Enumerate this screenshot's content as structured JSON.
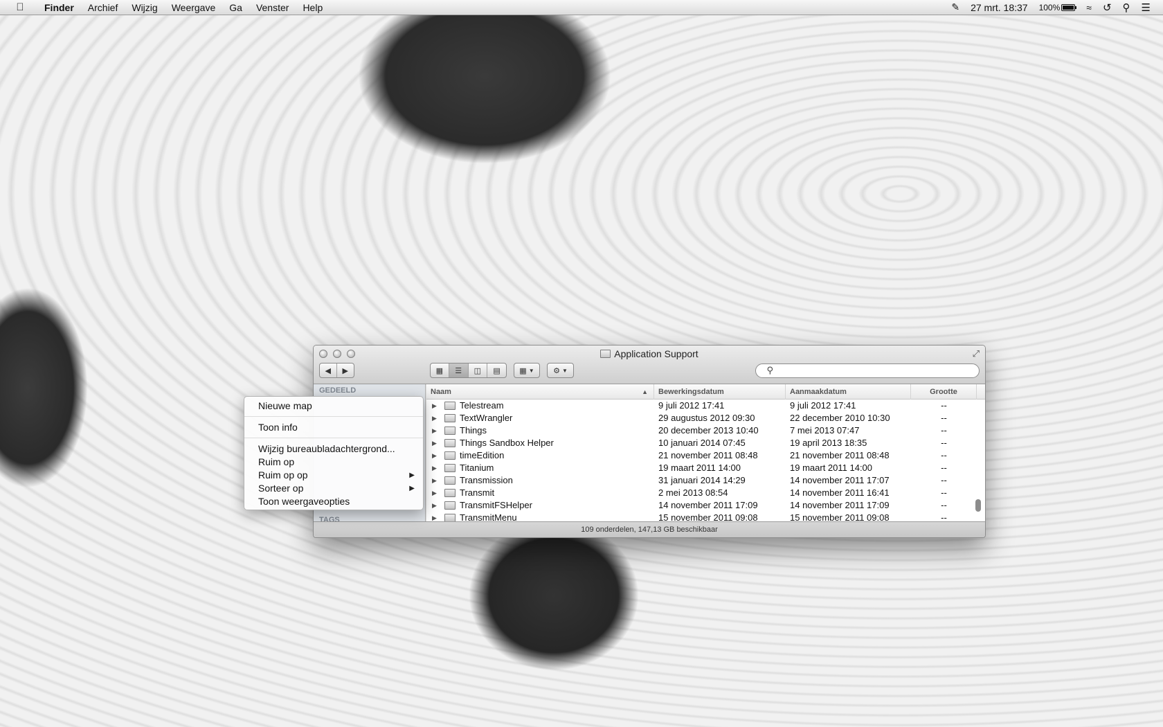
{
  "menubar": {
    "app_name": "Finder",
    "items": [
      "Archief",
      "Wijzig",
      "Weergave",
      "Ga",
      "Venster",
      "Help"
    ],
    "datetime": "27 mrt. 18:37",
    "battery_text": "100%",
    "battery_level": 1.0
  },
  "window": {
    "title": "Application Support",
    "search": {
      "value": "",
      "placeholder": ""
    },
    "status": "109 onderdelen, 147,13 GB beschikbaar"
  },
  "sidebar": {
    "shared_header": "GEDEELD",
    "tags_header": "TAGS"
  },
  "table": {
    "columns": {
      "name": "Naam",
      "modified": "Bewerkingsdatum",
      "created": "Aanmaakdatum",
      "size": "Grootte"
    },
    "rows": [
      {
        "name": "Telestream",
        "modified": "9 juli 2012 17:41",
        "created": "9 juli 2012 17:41",
        "size": "--"
      },
      {
        "name": "TextWrangler",
        "modified": "29 augustus 2012 09:30",
        "created": "22 december 2010 10:30",
        "size": "--"
      },
      {
        "name": "Things",
        "modified": "20 december 2013 10:40",
        "created": "7 mei 2013 07:47",
        "size": "--"
      },
      {
        "name": "Things Sandbox Helper",
        "modified": "10 januari 2014 07:45",
        "created": "19 april 2013 18:35",
        "size": "--"
      },
      {
        "name": "timeEdition",
        "modified": "21 november 2011 08:48",
        "created": "21 november 2011 08:48",
        "size": "--"
      },
      {
        "name": "Titanium",
        "modified": "19 maart 2011 14:00",
        "created": "19 maart 2011 14:00",
        "size": "--"
      },
      {
        "name": "Transmission",
        "modified": "31 januari 2014 14:29",
        "created": "14 november 2011 17:07",
        "size": "--"
      },
      {
        "name": "Transmit",
        "modified": "2 mei 2013 08:54",
        "created": "14 november 2011 16:41",
        "size": "--"
      },
      {
        "name": "TransmitFSHelper",
        "modified": "14 november 2011 17:09",
        "created": "14 november 2011 17:09",
        "size": "--"
      },
      {
        "name": "TransmitMenu",
        "modified": "15 november 2011 09:08",
        "created": "15 november 2011 09:08",
        "size": "--"
      }
    ]
  },
  "context_menu": {
    "items": [
      {
        "label": "Nieuwe map"
      },
      {
        "label": "Toon info"
      },
      {
        "label": "Wijzig bureaubladachtergrond..."
      },
      {
        "label": "Ruim op"
      },
      {
        "label": "Ruim op op"
      },
      {
        "label": "Sorteer op"
      },
      {
        "label": "Toon weergaveopties"
      }
    ]
  }
}
